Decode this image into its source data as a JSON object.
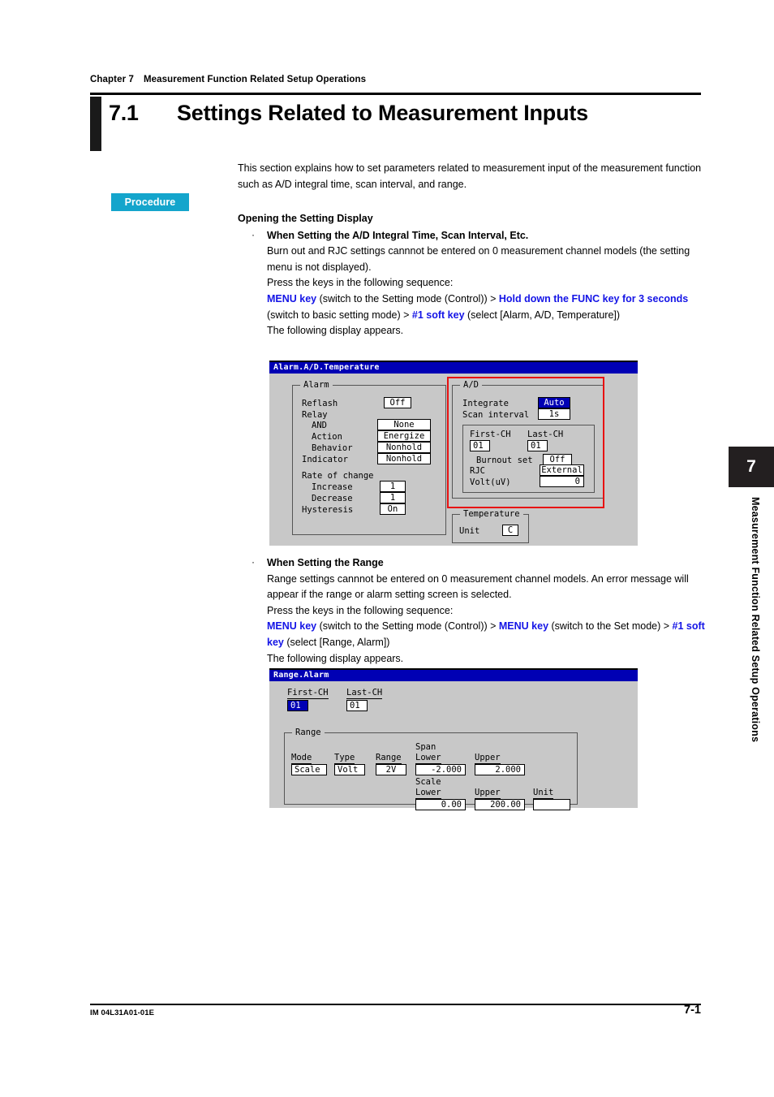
{
  "header": {
    "chapter_label": "Chapter 7",
    "chapter_title": "Measurement Function Related Setup Operations"
  },
  "section": {
    "number": "7.1",
    "title": "Settings Related to Measurement Inputs"
  },
  "intro": "This section explains how to set parameters related to measurement input of the measurement function such as A/D integral time, scan interval, and range.",
  "procedure_badge": "Procedure",
  "body": {
    "opening_heading": "Opening the Setting Display",
    "bullet_char": "·",
    "item1": {
      "subheading": "When Setting the A/D Integral Time, Scan Interval, Etc.",
      "note": "Burn out and RJC settings cannnot be entered on 0 measurement channel models (the setting menu is not displayed).",
      "press_line": "Press the keys in the following sequence:",
      "seq": {
        "k1": "MENU key",
        "t1": " (switch to the Setting mode (Control)) > ",
        "k2": "Hold down the FUNC key for 3 seconds",
        "t2": " (switch to basic setting mode) > ",
        "k3": "#1 soft key",
        "t3": " (select [Alarm, A/D, Temperature])"
      },
      "appears": "The following display appears."
    },
    "item2": {
      "subheading": "When Setting the Range",
      "note": "Range settings cannnot be entered on 0 measurement channel models.  An error message will appear if the range or alarm setting screen is selected.",
      "press_line": "Press the keys in the following sequence:",
      "seq": {
        "k1": "MENU key",
        "t1": " (switch to the Setting mode (Control)) > ",
        "k2": "MENU key",
        "t2": " (switch to the Set mode) > ",
        "k3": "#1 soft key",
        "t3": " (select [Range, Alarm])"
      },
      "appears": "The following display appears."
    }
  },
  "screen1": {
    "title": "Alarm.A/D.Temperature",
    "alarm_group": {
      "caption": "Alarm",
      "reflash_label": "Reflash",
      "reflash_value": "Off",
      "relay_label": "Relay",
      "and_label": "AND",
      "and_value": "None",
      "action_label": "Action",
      "action_value": "Energize",
      "behavior_label": "Behavior",
      "behavior_value": "Nonhold",
      "indicator_label": "Indicator",
      "indicator_value": "Nonhold",
      "rate_label": "Rate of change",
      "increase_label": "Increase",
      "increase_value": "1",
      "decrease_label": "Decrease",
      "decrease_value": "1",
      "hysteresis_label": "Hysteresis",
      "hysteresis_value": "On"
    },
    "ad_group": {
      "caption": "A/D",
      "integrate_label": "Integrate",
      "integrate_value": "Auto",
      "scan_label": "Scan interval",
      "scan_value": "1s",
      "first_ch_label": "First-CH",
      "first_ch_value": "01",
      "last_ch_label": "Last-CH",
      "last_ch_value": "01",
      "burnout_label": "Burnout set",
      "burnout_value": "Off",
      "rjc_label": "RJC",
      "rjc_value": "External",
      "volt_label": "Volt(uV)",
      "volt_value": "0"
    },
    "temperature_group": {
      "caption": "Temperature",
      "unit_label": "Unit",
      "unit_value": "C"
    },
    "highlight_color": "#E81111"
  },
  "screen2": {
    "title": "Range.Alarm",
    "first_ch_label": "First-CH",
    "first_ch_value": "01",
    "last_ch_label": "Last-CH",
    "last_ch_value": "01",
    "range_group": {
      "caption": "Range",
      "mode_label": "Mode",
      "mode_value": "Scale",
      "type_label": "Type",
      "type_value": "Volt",
      "range_label": "Range",
      "range_value": "2V",
      "span_label": "Span",
      "span_lower_label": "Lower",
      "span_lower_value": "-2.000",
      "span_upper_label": "Upper",
      "span_upper_value": "2.000",
      "scale_label": "Scale",
      "scale_lower_label": "Lower",
      "scale_lower_value": "0.00",
      "scale_upper_label": "Upper",
      "scale_upper_value": "200.00",
      "unit_label": "Unit",
      "unit_value": ""
    }
  },
  "side_tab": {
    "number": "7",
    "label": "Measurement Function Related Setup Operations"
  },
  "footer": {
    "doc_id": "IM 04L31A01-01E",
    "page": "7-1"
  }
}
